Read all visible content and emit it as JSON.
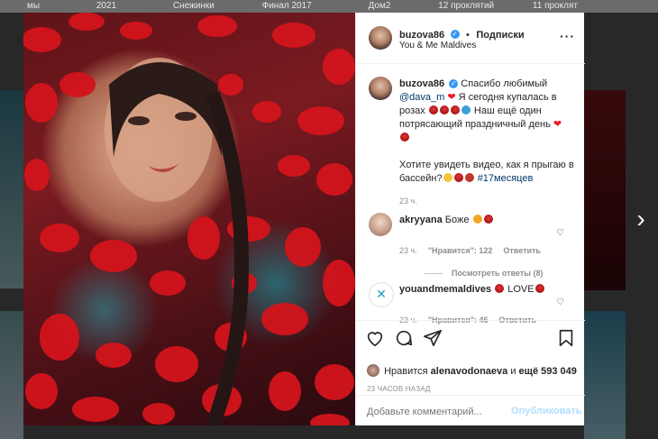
{
  "background": {
    "strip_labels": [
      "мы",
      "2021",
      "Снежинки",
      "Финал 2017",
      "Дом2",
      "12 проклятий",
      "11 проклят"
    ]
  },
  "post": {
    "author": "buzova86",
    "follow_label": "Подписки",
    "location": "You & Me Maldives",
    "caption_author": "buzova86",
    "caption_part1": "Спасибо любимый",
    "caption_mention": "@dava_m",
    "caption_part2": "Я сегодня купалась в розах",
    "caption_part3": "Наш ещё один потрясающий праздничный день",
    "caption_part4": "Хотите увидеть видео, как я прыгаю в бассейн?",
    "caption_hashtag": "#17месяцев",
    "caption_time": "23 ч."
  },
  "comments": [
    {
      "author": "akryyana",
      "text": "Боже",
      "time": "23 ч.",
      "likes": "\"Нравится\": 122",
      "reply": "Ответить"
    },
    {
      "author": "youandmemaldives",
      "text": "LOVE",
      "time": "23 ч.",
      "likes": "\"Нравится\": 46",
      "reply": "Ответить"
    }
  ],
  "view_replies": "Посмотреть ответы (8)",
  "likes_prefix": "Нравится",
  "likes_user": "alenavodonaeva",
  "likes_middle": "и",
  "likes_rest": "ещё 593 049",
  "post_age": "23 ЧАСОВ НАЗАД",
  "comment_input": {
    "placeholder": "Добавьте комментарий...",
    "publish_label": "Опубликовать"
  },
  "colors": {
    "accent": "#3897f0",
    "publish_disabled": "#b2dffc",
    "heart": "#ed1c24"
  },
  "icons": [
    "more-options-icon",
    "heart-icon",
    "comment-icon",
    "share-icon",
    "bookmark-icon",
    "next-arrow-icon",
    "verified-icon"
  ]
}
